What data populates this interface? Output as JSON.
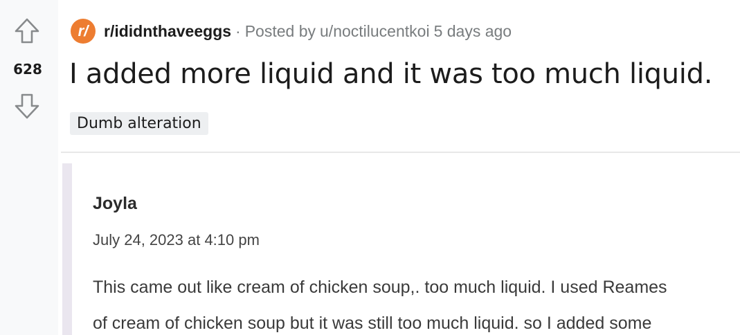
{
  "vote": {
    "score": "628",
    "upvote_icon": "arrow-up-outline-icon",
    "downvote_icon": "arrow-down-outline-icon"
  },
  "post": {
    "subreddit_icon_text": "r/",
    "subreddit": "r/ididnthaveeggs",
    "separator": "·",
    "posted_by_prefix": "Posted by",
    "author": "u/noctilucentkoi",
    "age": "5 days ago",
    "title": "I added more liquid and it was too much liquid.",
    "flair": "Dumb alteration"
  },
  "image": {
    "comment_author": "Joyla",
    "comment_date": "July 24, 2023 at 4:10 pm",
    "comment_lines": [
      "This came out like cream of chicken soup,. too much liquid. I used Reames",
      "of cream of chicken soup but it was still too much liquid. so I added some"
    ]
  },
  "colors": {
    "subreddit_icon_bg": "#ed7d31",
    "meta_text": "#787c7e",
    "flair_bg": "#edeff1"
  }
}
